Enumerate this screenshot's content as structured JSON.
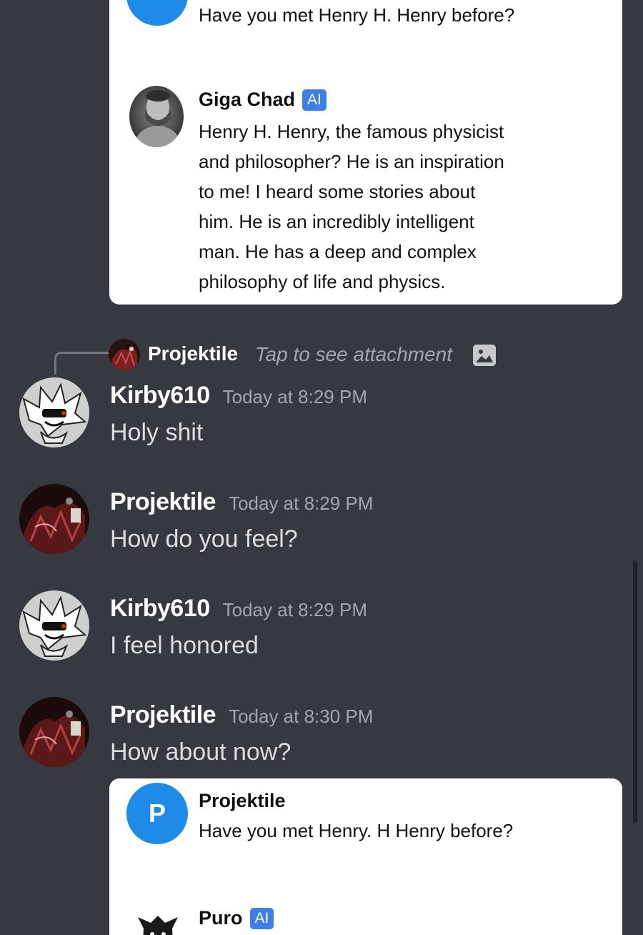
{
  "top_card": {
    "user_prompt": "Have you met Henry H. Henry before?",
    "ai_name": "Giga Chad",
    "ai_badge": "AI",
    "ai_lines": [
      "Henry H. Henry, the famous physicist",
      "and philosopher? He is an inspiration",
      "to me! I heard some stories about",
      "him. He is an incredibly intelligent",
      "man. He has a deep and complex",
      "philosophy of life and physics."
    ]
  },
  "reply": {
    "name": "Projektile",
    "text": "Tap to see attachment",
    "icon": "image-icon"
  },
  "messages": [
    {
      "author": "Kirby610",
      "time": "Today at 8:29 PM",
      "text": "Holy shit"
    },
    {
      "author": "Projektile",
      "time": "Today at 8:29 PM",
      "text": "How do you feel?"
    },
    {
      "author": "Kirby610",
      "time": "Today at 8:29 PM",
      "text": "I feel honored"
    },
    {
      "author": "Projektile",
      "time": "Today at 8:30 PM",
      "text": "How about now?"
    }
  ],
  "bottom_card": {
    "user_initial": "P",
    "user_name": "Projektile",
    "user_prompt": "Have you met Henry. H Henry before?",
    "ai_name": "Puro",
    "ai_badge": "AI"
  },
  "colors": {
    "background": "#36393f",
    "card": "#ffffff",
    "accent_blue": "#1f8be8",
    "ai_badge": "#3d7fe6",
    "timestamp": "#a3a6aa"
  }
}
